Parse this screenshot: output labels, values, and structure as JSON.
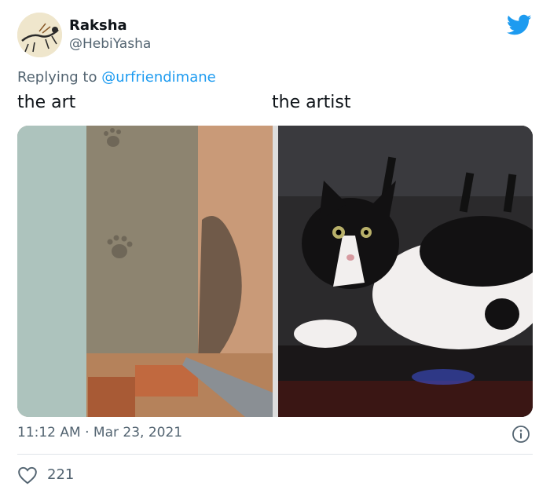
{
  "author": {
    "display_name": "Raksha",
    "handle": "@HebiYasha"
  },
  "reply": {
    "prefix": "Replying to ",
    "mention": "@urfriendimane"
  },
  "captions": {
    "left": "the art",
    "right": "the artist"
  },
  "media": [
    {
      "description_icon": "photo-pawprints-on-plaster"
    },
    {
      "description_icon": "photo-black-white-cat"
    }
  ],
  "meta": {
    "time": "11:12 AM",
    "separator": " · ",
    "date": "Mar 23, 2021"
  },
  "engagement": {
    "likes": "221"
  },
  "icons": {
    "brand": "twitter-bird-icon",
    "info": "info-icon",
    "like": "heart-icon"
  },
  "colors": {
    "accent": "#1d9bf0",
    "muted_text": "#536471",
    "primary_text": "#0f1419"
  }
}
